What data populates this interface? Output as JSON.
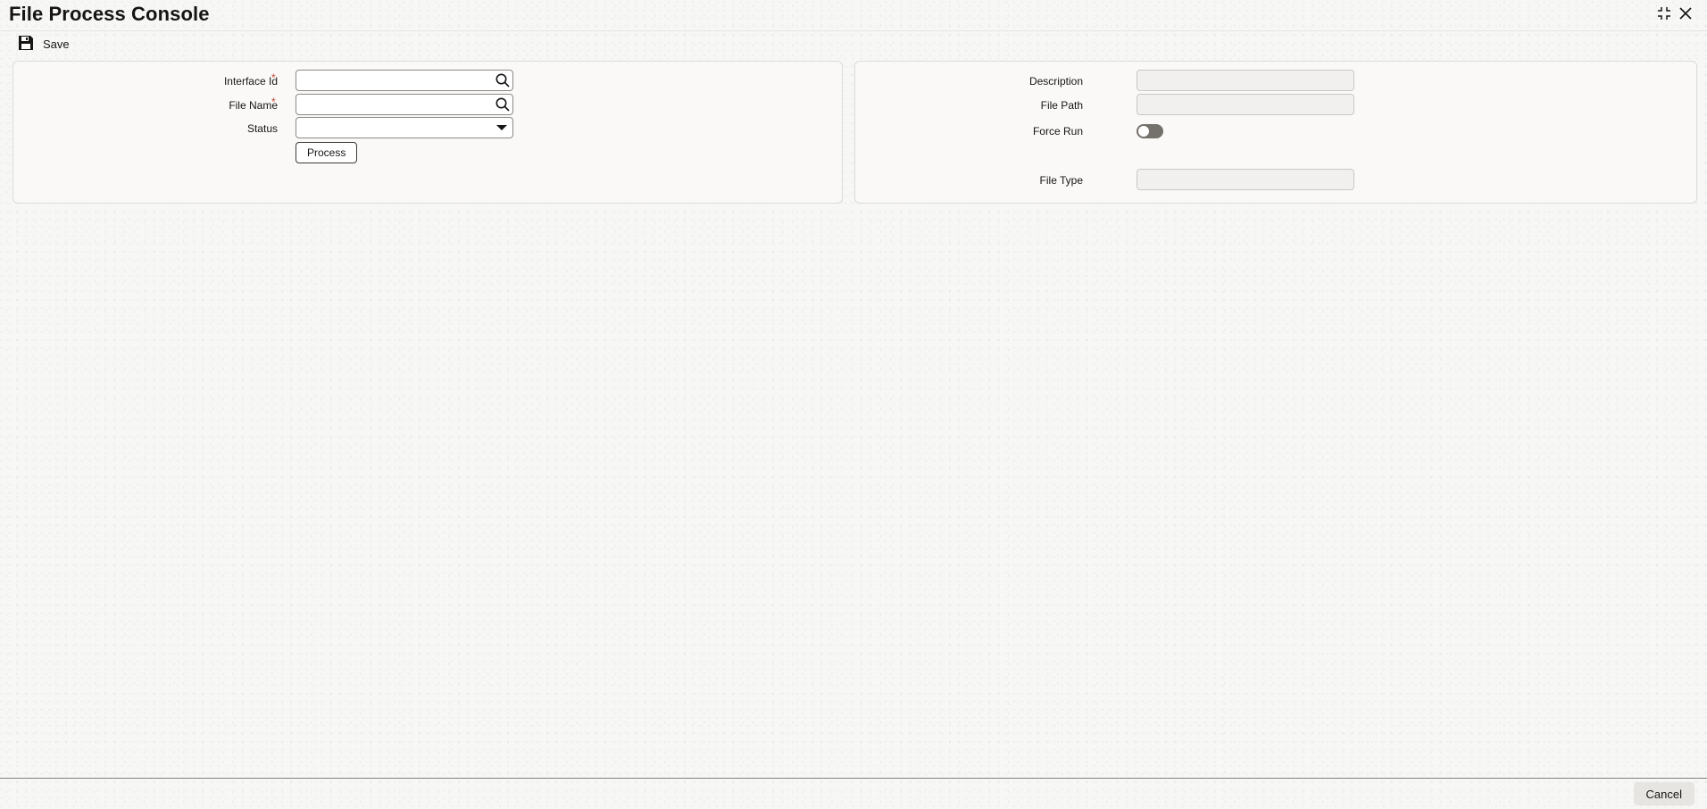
{
  "window": {
    "title": "File Process Console",
    "icons": [
      "minimize-icon",
      "close-icon"
    ]
  },
  "toolbar": {
    "save_label": "Save",
    "save_icon": "save-icon"
  },
  "left_panel": {
    "interface_id": {
      "label": "Interface Id",
      "required_mark": "*",
      "value": "",
      "icon": "search-icon"
    },
    "file_name": {
      "label": "File Name",
      "required_mark": "*",
      "value": "",
      "icon": "search-icon"
    },
    "status": {
      "label": "Status",
      "value": "",
      "icon": "chevron-down-icon"
    },
    "process_label": "Process"
  },
  "right_panel": {
    "description": {
      "label": "Description",
      "value": ""
    },
    "file_path": {
      "label": "File Path",
      "value": ""
    },
    "force_run": {
      "label": "Force Run",
      "checked": false
    },
    "file_type": {
      "label": "File Type",
      "value": ""
    }
  },
  "footer": {
    "cancel_label": "Cancel"
  },
  "colors": {
    "required": "#c74634",
    "toggle_off": "#74706b",
    "background": "#f7f7f6"
  }
}
